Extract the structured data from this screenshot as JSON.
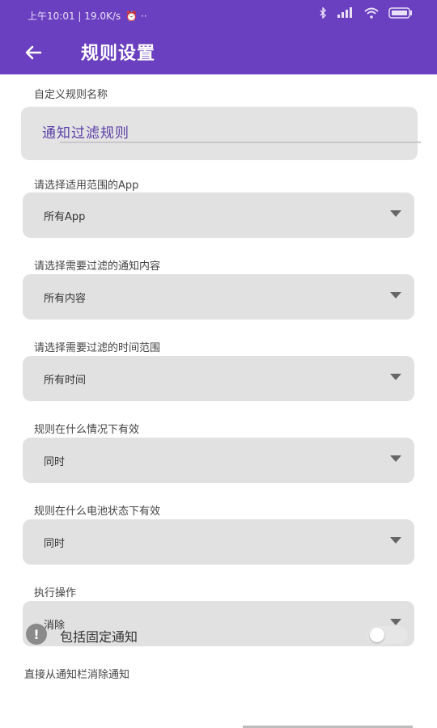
{
  "status_bar": {
    "time_text": "上午10:01 | 19.0K/s",
    "extra": "⏰ ··",
    "icons": [
      "bluetooth-icon",
      "signal-icon",
      "wifi-icon",
      "battery-icon"
    ]
  },
  "app_bar": {
    "title": "规则设置"
  },
  "form": {
    "name_label": "自定义规则名称",
    "name_value": "通知过滤规则",
    "fields": [
      {
        "label": "请选择适用范围的App",
        "value": "所有App"
      },
      {
        "label": "请选择需要过滤的通知内容",
        "value": "所有内容"
      },
      {
        "label": "请选择需要过滤的时间范围",
        "value": "所有时间"
      },
      {
        "label": "规则在什么情况下有效",
        "value": "同时"
      },
      {
        "label": "规则在什么电池状态下有效",
        "value": "同时"
      },
      {
        "label": "执行操作",
        "value": "消除"
      }
    ],
    "note": "直接从通知栏消除通知",
    "toggle": {
      "label": "包括固定通知",
      "on": false
    }
  },
  "colors": {
    "accent": "#6a3fc0"
  }
}
